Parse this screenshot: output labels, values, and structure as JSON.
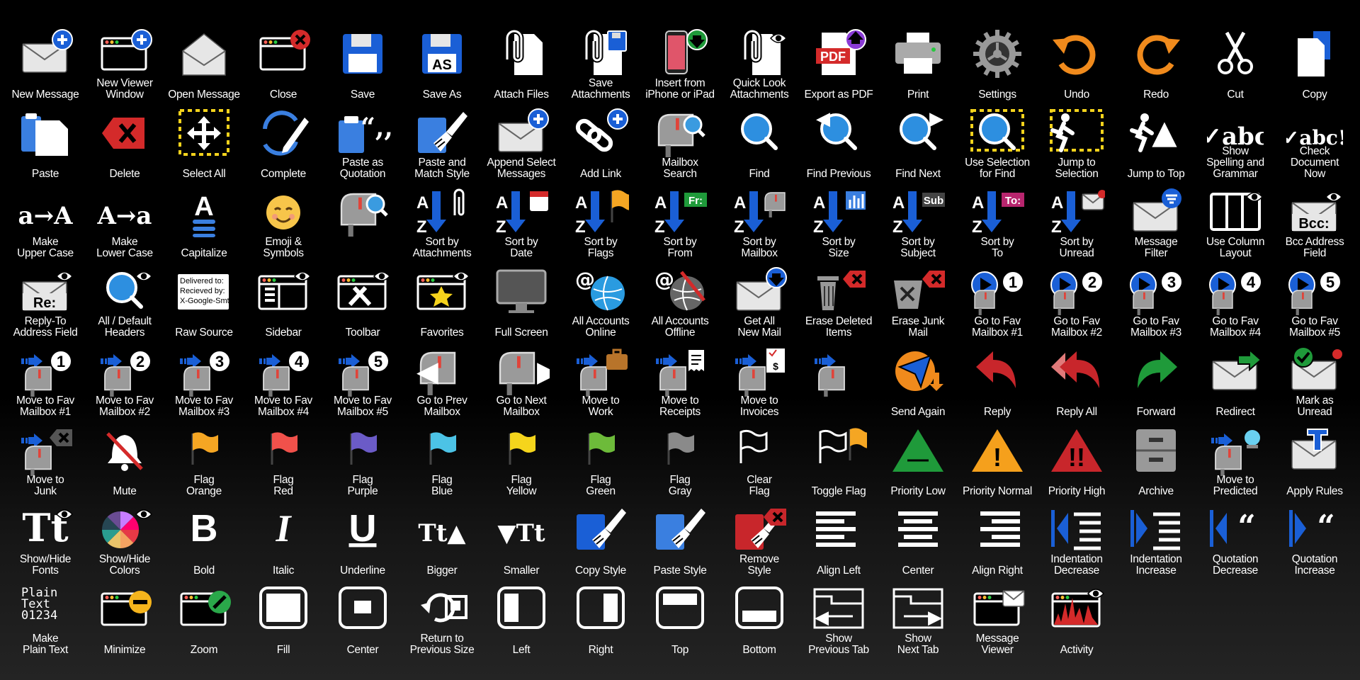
{
  "icons": [
    {
      "label": "New Message",
      "icon": "new-message-icon",
      "glyph": "env",
      "badge": "plus",
      "badge_color": "#1a5fd6"
    },
    {
      "label": "New Viewer\nWindow",
      "icon": "new-viewer-window-icon",
      "glyph": "win",
      "badge": "plus",
      "badge_color": "#1a5fd6"
    },
    {
      "label": "Open Message",
      "icon": "open-message-icon",
      "glyph": "envopen"
    },
    {
      "label": "Close",
      "icon": "close-window-icon",
      "glyph": "win",
      "badge": "x",
      "badge_color": "#d42a2a"
    },
    {
      "label": "Save",
      "icon": "save-icon",
      "glyph": "disk"
    },
    {
      "label": "Save As",
      "icon": "save-as-icon",
      "glyph": "disk",
      "text": "AS"
    },
    {
      "label": "Attach Files",
      "icon": "attach-files-icon",
      "glyph": "clip"
    },
    {
      "label": "Save\nAttachments",
      "icon": "save-attachments-icon",
      "glyph": "clip",
      "badge": "disk",
      "badge_color": "#1a5fd6"
    },
    {
      "label": "Insert from\niPhone or iPad",
      "icon": "insert-from-iphone-icon",
      "glyph": "phone",
      "badge": "down",
      "badge_color": "#1f9a3a"
    },
    {
      "label": "Quick Look\nAttachments",
      "icon": "quick-look-attachments-icon",
      "glyph": "clip",
      "badge": "eye",
      "badge_color": "#ffffff"
    },
    {
      "label": "Export as PDF",
      "icon": "export-pdf-icon",
      "glyph": "doc",
      "text": "PDF",
      "accent": "#d42a2a",
      "badge": "up",
      "badge_color": "#8a3bd6"
    },
    {
      "label": "Print",
      "icon": "printer-icon",
      "glyph": "print"
    },
    {
      "label": "Settings",
      "icon": "gear-icon",
      "glyph": "gear"
    },
    {
      "label": "Undo",
      "icon": "undo-icon",
      "glyph": "undo",
      "accent": "#f08a1c"
    },
    {
      "label": "Redo",
      "icon": "redo-icon",
      "glyph": "redo",
      "accent": "#f08a1c"
    },
    {
      "label": "Cut",
      "icon": "scissors-icon",
      "glyph": "scissors"
    },
    {
      "label": "Copy",
      "icon": "copy-icon",
      "glyph": "copy"
    },
    {
      "label": "Paste",
      "icon": "paste-icon",
      "glyph": "paste"
    },
    {
      "label": "Delete",
      "icon": "delete-icon",
      "glyph": "delete",
      "accent": "#d42a2a"
    },
    {
      "label": "Select All",
      "icon": "select-all-icon",
      "glyph": "move",
      "dashed": true
    },
    {
      "label": "Complete",
      "icon": "complete-icon",
      "glyph": "sync",
      "accent": "#3a7fe0"
    },
    {
      "label": "Paste as\nQuotation",
      "icon": "paste-as-quotation-icon",
      "glyph": "clipboard",
      "text": "“,,",
      "accent": "#3a7fe0"
    },
    {
      "label": "Paste and\nMatch Style",
      "icon": "paste-match-style-icon",
      "glyph": "brush",
      "accent": "#3a7fe0"
    },
    {
      "label": "Append Select\nMessages",
      "icon": "append-messages-icon",
      "glyph": "env",
      "dashed": true,
      "badge": "plus",
      "badge_color": "#1a5fd6"
    },
    {
      "label": "Add Link",
      "icon": "add-link-icon",
      "glyph": "link",
      "badge": "plus",
      "badge_color": "#1a5fd6"
    },
    {
      "label": "Mailbox\nSearch",
      "icon": "mailbox-search-icon",
      "glyph": "mailbox",
      "badge": "search",
      "badge_color": "#3a9be0"
    },
    {
      "label": "Find",
      "icon": "find-icon",
      "glyph": "search"
    },
    {
      "label": "Find Previous",
      "icon": "find-previous-icon",
      "glyph": "search",
      "text": "◀"
    },
    {
      "label": "Find Next",
      "icon": "find-next-icon",
      "glyph": "search",
      "text": "▶"
    },
    {
      "label": "Use Selection\nfor Find",
      "icon": "use-selection-find-icon",
      "glyph": "search",
      "dashed": true
    },
    {
      "label": "Jump to\nSelection",
      "icon": "jump-to-selection-icon",
      "glyph": "run",
      "dashed": true
    },
    {
      "label": "Jump to Top",
      "icon": "jump-to-top-icon",
      "glyph": "run",
      "text": "▲"
    },
    {
      "label": "Show\nSpelling and\nGrammar",
      "icon": "spelling-grammar-icon",
      "glyph": "text",
      "text": "✓abc"
    },
    {
      "label": "Check\nDocument\nNow",
      "icon": "check-document-icon",
      "glyph": "text",
      "text": "✓abc!"
    },
    {
      "label": "Make\nUpper Case",
      "icon": "upper-case-icon",
      "glyph": "text",
      "text": "a→A"
    },
    {
      "label": "Make\nLower Case",
      "icon": "lower-case-icon",
      "glyph": "text",
      "text": "A→a"
    },
    {
      "label": "Capitalize",
      "icon": "capitalize-icon",
      "glyph": "capitalize"
    },
    {
      "label": "Emoji &\nSymbols",
      "icon": "emoji-icon",
      "glyph": "emoji"
    },
    {
      "label": "",
      "icon": "mailbox-search-alt-icon",
      "glyph": "mailbox",
      "badge": "search",
      "badge_color": "#3a9be0"
    },
    {
      "label": "Sort by\nAttachments",
      "icon": "sort-attachments-icon",
      "glyph": "sort",
      "badge": "clip",
      "badge_color": "#ffffff"
    },
    {
      "label": "Sort by\nDate",
      "icon": "sort-date-icon",
      "glyph": "sort",
      "badge": "cal",
      "badge_color": "#d42a2a"
    },
    {
      "label": "Sort by\nFlags",
      "icon": "sort-flags-icon",
      "glyph": "sort",
      "badge": "flag",
      "badge_color": "#f5a623"
    },
    {
      "label": "Sort by\nFrom",
      "icon": "sort-from-icon",
      "glyph": "sort",
      "badge": "tag",
      "badge_color": "#1f9a3a",
      "text": "Fr:"
    },
    {
      "label": "Sort by\nMailbox",
      "icon": "sort-mailbox-icon",
      "glyph": "sort",
      "badge": "mailbox",
      "badge_color": "#888888"
    },
    {
      "label": "Sort by\nSize",
      "icon": "sort-size-icon",
      "glyph": "sort",
      "badge": "bars",
      "badge_color": "#3a7fe0"
    },
    {
      "label": "Sort by\nSubject",
      "icon": "sort-subject-icon",
      "glyph": "sort",
      "badge": "tag",
      "badge_color": "#444444",
      "text": "Sub"
    },
    {
      "label": "Sort by\nTo",
      "icon": "sort-to-icon",
      "glyph": "sort",
      "badge": "tag",
      "badge_color": "#b8256e",
      "text": "To:"
    },
    {
      "label": "Sort by\nUnread",
      "icon": "sort-unread-icon",
      "glyph": "sort",
      "badge": "env",
      "badge_color": "#d42a2a"
    },
    {
      "label": "Message\nFilter",
      "icon": "message-filter-icon",
      "glyph": "env",
      "badge": "filter",
      "badge_color": "#1a5fd6"
    },
    {
      "label": "Use Column\nLayout",
      "icon": "column-layout-icon",
      "glyph": "columns",
      "badge": "eye",
      "badge_color": "#ffffff"
    },
    {
      "label": "Bcc Address\nField",
      "icon": "bcc-field-icon",
      "glyph": "env",
      "text": "Bcc:",
      "badge": "eye",
      "badge_color": "#ffffff"
    },
    {
      "label": "Reply-To\nAddress Field",
      "icon": "reply-to-field-icon",
      "glyph": "env",
      "text": "Re:",
      "badge": "eye",
      "badge_color": "#ffffff"
    },
    {
      "label": "All / Default\nHeaders",
      "icon": "headers-icon",
      "glyph": "search",
      "badge": "eye",
      "badge_color": "#ffffff"
    },
    {
      "label": "Raw Source",
      "icon": "raw-source-icon",
      "glyph": "textbox",
      "text": "Delivered to:\nRecieved by:\nX-Google-Smtp"
    },
    {
      "label": "Sidebar",
      "icon": "sidebar-icon",
      "glyph": "sidebar",
      "badge": "eye",
      "badge_color": "#ffffff"
    },
    {
      "label": "Toolbar",
      "icon": "toolbar-icon",
      "glyph": "tools",
      "badge": "eye",
      "badge_color": "#ffffff"
    },
    {
      "label": "Favorites",
      "icon": "favorites-icon",
      "glyph": "star",
      "accent": "#f5d31c",
      "badge": "eye",
      "badge_color": "#ffffff"
    },
    {
      "label": "Full Screen",
      "icon": "full-screen-icon",
      "glyph": "monitor"
    },
    {
      "label": "All Accounts\nOnline",
      "icon": "accounts-online-icon",
      "glyph": "globe",
      "accent": "#2a9be0"
    },
    {
      "label": "All Accounts\nOffline",
      "icon": "accounts-offline-icon",
      "glyph": "globe",
      "accent": "#666666",
      "badge": "slash",
      "badge_color": "#d42a2a"
    },
    {
      "label": "Get All\nNew Mail",
      "icon": "get-new-mail-icon",
      "glyph": "env",
      "badge": "down",
      "badge_color": "#1a5fd6"
    },
    {
      "label": "Erase Deleted\nItems",
      "icon": "erase-deleted-icon",
      "glyph": "trash",
      "badge": "xtag",
      "badge_color": "#d42a2a"
    },
    {
      "label": "Erase Junk\nMail",
      "icon": "erase-junk-icon",
      "glyph": "junk",
      "badge": "xtag",
      "badge_color": "#d42a2a"
    },
    {
      "label": "Go to Fav\nMailbox #1",
      "icon": "go-fav-1-icon",
      "glyph": "play",
      "accent": "#1a5fd6",
      "badge": "num",
      "text": "1"
    },
    {
      "label": "Go to Fav\nMailbox #2",
      "icon": "go-fav-2-icon",
      "glyph": "play",
      "accent": "#1a5fd6",
      "badge": "num",
      "text": "2"
    },
    {
      "label": "Go to Fav\nMailbox #3",
      "icon": "go-fav-3-icon",
      "glyph": "play",
      "accent": "#1a5fd6",
      "badge": "num",
      "text": "3"
    },
    {
      "label": "Go to Fav\nMailbox #4",
      "icon": "go-fav-4-icon",
      "glyph": "play",
      "accent": "#1a5fd6",
      "badge": "num",
      "text": "4"
    },
    {
      "label": "Go to Fav\nMailbox #5",
      "icon": "go-fav-5-icon",
      "glyph": "play",
      "accent": "#1a5fd6",
      "badge": "num",
      "text": "5"
    },
    {
      "label": "Move to Fav\nMailbox #1",
      "icon": "move-fav-1-icon",
      "glyph": "movebox",
      "badge": "num",
      "text": "1"
    },
    {
      "label": "Move to Fav\nMailbox #2",
      "icon": "move-fav-2-icon",
      "glyph": "movebox",
      "badge": "num",
      "text": "2"
    },
    {
      "label": "Move to Fav\nMailbox #3",
      "icon": "move-fav-3-icon",
      "glyph": "movebox",
      "badge": "num",
      "text": "3"
    },
    {
      "label": "Move to Fav\nMailbox #4",
      "icon": "move-fav-4-icon",
      "glyph": "movebox",
      "badge": "num",
      "text": "4"
    },
    {
      "label": "Move to Fav\nMailbox #5",
      "icon": "move-fav-5-icon",
      "glyph": "movebox",
      "badge": "num",
      "text": "5"
    },
    {
      "label": "Go to Prev\nMailbox",
      "icon": "prev-mailbox-icon",
      "glyph": "mailbox",
      "text": "◀"
    },
    {
      "label": "Go to Next\nMailbox",
      "icon": "next-mailbox-icon",
      "glyph": "mailbox",
      "text": "▶"
    },
    {
      "label": "Move to\nWork",
      "icon": "move-work-icon",
      "glyph": "movebox",
      "badge": "briefcase",
      "badge_color": "#b8742a"
    },
    {
      "label": "Move to\nReceipts",
      "icon": "move-receipts-icon",
      "glyph": "movebox",
      "badge": "receipt",
      "badge_color": "#ffffff"
    },
    {
      "label": "Move to\nInvoices",
      "icon": "move-invoices-icon",
      "glyph": "movebox",
      "badge": "invoice",
      "badge_color": "#ffffff",
      "text": "$"
    },
    {
      "label": "",
      "icon": "move-mailbox-icon",
      "glyph": "movebox"
    },
    {
      "label": "Send Again",
      "icon": "send-again-icon",
      "glyph": "send",
      "accent": "#f08a1c"
    },
    {
      "label": "Reply",
      "icon": "reply-icon",
      "glyph": "reply",
      "accent": "#c8262b"
    },
    {
      "label": "Reply All",
      "icon": "reply-all-icon",
      "glyph": "replyall",
      "accent": "#c8262b"
    },
    {
      "label": "Forward",
      "icon": "forward-icon",
      "glyph": "forward",
      "accent": "#1f9a3a"
    },
    {
      "label": "Redirect",
      "icon": "redirect-icon",
      "glyph": "env",
      "badge": "rarrow",
      "badge_color": "#1f9a3a"
    },
    {
      "label": "Mark as\nUnread",
      "icon": "mark-unread-icon",
      "glyph": "env",
      "badge": "check",
      "badge_color": "#1f9a3a"
    },
    {
      "label": "Move to\nJunk",
      "icon": "move-junk-icon",
      "glyph": "movebox",
      "badge": "xtag",
      "badge_color": "#555555"
    },
    {
      "label": "Mute",
      "icon": "mute-icon",
      "glyph": "bell",
      "badge_color": "#d42a2a"
    },
    {
      "label": "Flag\nOrange",
      "icon": "flag-orange-icon",
      "glyph": "flag",
      "accent": "#f5a623"
    },
    {
      "label": "Flag\nRed",
      "icon": "flag-red-icon",
      "glyph": "flag",
      "accent": "#f0514b"
    },
    {
      "label": "Flag\nPurple",
      "icon": "flag-purple-icon",
      "glyph": "flag",
      "accent": "#6b5bc7"
    },
    {
      "label": "Flag\nBlue",
      "icon": "flag-blue-icon",
      "glyph": "flag",
      "accent": "#4cc3e6"
    },
    {
      "label": "Flag\nYellow",
      "icon": "flag-yellow-icon",
      "glyph": "flag",
      "accent": "#f5d51c"
    },
    {
      "label": "Flag\nGreen",
      "icon": "flag-green-icon",
      "glyph": "flag",
      "accent": "#6dbb3a"
    },
    {
      "label": "Flag\nGray",
      "icon": "flag-gray-icon",
      "glyph": "flag",
      "accent": "#8a8a8a"
    },
    {
      "label": "Clear\nFlag",
      "icon": "clear-flag-icon",
      "glyph": "flagoutline"
    },
    {
      "label": "Toggle Flag",
      "icon": "toggle-flag-icon",
      "glyph": "flagoutline",
      "badge": "flag",
      "badge_color": "#f5a623"
    },
    {
      "label": "Priority Low",
      "icon": "priority-low-icon",
      "glyph": "triangle",
      "accent": "#1f9a3a",
      "text": "—"
    },
    {
      "label": "Priority Normal",
      "icon": "priority-normal-icon",
      "glyph": "triangle",
      "accent": "#f5a01c",
      "text": "!"
    },
    {
      "label": "Priority High",
      "icon": "priority-high-icon",
      "glyph": "triangle",
      "accent": "#c8262b",
      "text": "!!"
    },
    {
      "label": "Archive",
      "icon": "archive-icon",
      "glyph": "archive"
    },
    {
      "label": "Move to\nPredicted",
      "icon": "move-predicted-icon",
      "glyph": "movebox",
      "badge": "ball",
      "badge_color": "#6ad0f0"
    },
    {
      "label": "Apply Rules",
      "icon": "apply-rules-icon",
      "glyph": "env",
      "badge": "rules",
      "badge_color": "#1a5fd6"
    },
    {
      "label": "Show/Hide\nFonts",
      "icon": "show-hide-fonts-icon",
      "glyph": "text",
      "text": "Tt",
      "badge": "eye",
      "badge_color": "#ffffff"
    },
    {
      "label": "Show/Hide\nColors",
      "icon": "show-hide-colors-icon",
      "glyph": "colorwheel",
      "badge": "eye",
      "badge_color": "#ffffff"
    },
    {
      "label": "Bold",
      "icon": "bold-icon",
      "glyph": "text",
      "text": "B"
    },
    {
      "label": "Italic",
      "icon": "italic-icon",
      "glyph": "text",
      "text": "I"
    },
    {
      "label": "Underline",
      "icon": "underline-icon",
      "glyph": "text",
      "text": "U"
    },
    {
      "label": "Bigger",
      "icon": "bigger-icon",
      "glyph": "text",
      "text": "Tt▲"
    },
    {
      "label": "Smaller",
      "icon": "smaller-icon",
      "glyph": "text",
      "text": "▼Tt"
    },
    {
      "label": "Copy Style",
      "icon": "copy-style-icon",
      "glyph": "brush",
      "accent": "#1a5fd6"
    },
    {
      "label": "Paste Style",
      "icon": "paste-style-icon",
      "glyph": "brush",
      "accent": "#3a7fe0"
    },
    {
      "label": "Remove\nStyle",
      "icon": "remove-style-icon",
      "glyph": "brush",
      "accent": "#c8262b",
      "badge": "xtag",
      "badge_color": "#c8262b"
    },
    {
      "label": "Align Left",
      "icon": "align-left-icon",
      "glyph": "align",
      "text": "left"
    },
    {
      "label": "Center",
      "icon": "align-center-icon",
      "glyph": "align",
      "text": "center"
    },
    {
      "label": "Align Right",
      "icon": "align-right-icon",
      "glyph": "align",
      "text": "right"
    },
    {
      "label": "Indentation\nDecrease",
      "icon": "indent-decrease-icon",
      "glyph": "indent",
      "accent": "#1a5fd6",
      "text": "dec"
    },
    {
      "label": "Indentation\nIncrease",
      "icon": "indent-increase-icon",
      "glyph": "indent",
      "accent": "#1a5fd6",
      "text": "inc"
    },
    {
      "label": "Quotation\nDecrease",
      "icon": "quotation-decrease-icon",
      "glyph": "quote",
      "accent": "#1a5fd6",
      "text": "dec"
    },
    {
      "label": "Quotation\nIncrease",
      "icon": "quotation-increase-icon",
      "glyph": "quote",
      "accent": "#1a5fd6",
      "text": "inc"
    },
    {
      "label": "Make\nPlain Text",
      "icon": "plain-text-icon",
      "glyph": "mono",
      "text": "Plain\nText\n01234"
    },
    {
      "label": "Minimize",
      "icon": "minimize-icon",
      "glyph": "win",
      "badge": "minus",
      "badge_color": "#f5b41c"
    },
    {
      "label": "Zoom",
      "icon": "zoom-icon",
      "glyph": "win",
      "badge": "zoom",
      "badge_color": "#2aa84a"
    },
    {
      "label": "Fill",
      "icon": "fill-icon",
      "glyph": "frame",
      "text": "fill"
    },
    {
      "label": "Center",
      "icon": "center-window-icon",
      "glyph": "frame",
      "text": "center"
    },
    {
      "label": "Return to\nPrevious Size",
      "icon": "return-size-icon",
      "glyph": "restore"
    },
    {
      "label": "Left",
      "icon": "tile-left-icon",
      "glyph": "frame",
      "text": "left"
    },
    {
      "label": "Right",
      "icon": "tile-right-icon",
      "glyph": "frame",
      "text": "right"
    },
    {
      "label": "Top",
      "icon": "tile-top-icon",
      "glyph": "frame",
      "text": "top"
    },
    {
      "label": "Bottom",
      "icon": "tile-bottom-icon",
      "glyph": "frame",
      "text": "bottom"
    },
    {
      "label": "Show\nPrevious Tab",
      "icon": "previous-tab-icon",
      "glyph": "tab",
      "text": "◀"
    },
    {
      "label": "Show\nNext Tab",
      "icon": "next-tab-icon",
      "glyph": "tab",
      "text": "▶"
    },
    {
      "label": "Message\nViewer",
      "icon": "message-viewer-icon",
      "glyph": "win",
      "badge": "env",
      "badge_color": "#ffffff"
    },
    {
      "label": "Activity",
      "icon": "activity-icon",
      "glyph": "activity",
      "accent": "#d42a2a",
      "badge": "eye",
      "badge_color": "#ffffff"
    }
  ]
}
